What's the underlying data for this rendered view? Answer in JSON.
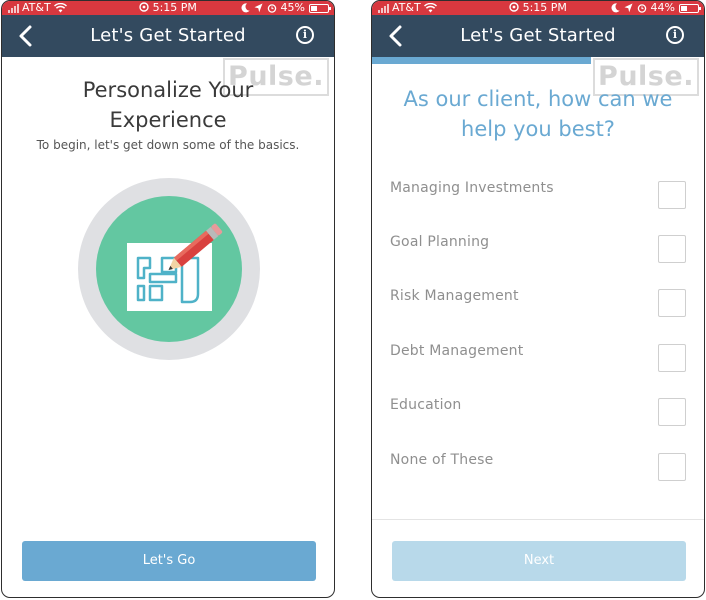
{
  "left_screen": {
    "status": {
      "carrier": "AT&T",
      "time": "5:15 PM",
      "battery": "45%",
      "battery_level": 0.45
    },
    "nav": {
      "title": "Let's Get Started"
    },
    "watermark": "Pulse.",
    "heading_line1": "Personalize Your",
    "heading_line2": "Experience",
    "subtitle": "To begin, let's get down some of the basics.",
    "button_label": "Let's Go"
  },
  "right_screen": {
    "status": {
      "carrier": "AT&T",
      "time": "5:15 PM",
      "battery": "44%",
      "battery_level": 0.44
    },
    "nav": {
      "title": "Let's Get Started"
    },
    "watermark": "Pulse.",
    "progress": 0.66,
    "question_line1": "As our client, how can we",
    "question_line2": "help you best?",
    "options": [
      {
        "label": "Managing Investments",
        "checked": false
      },
      {
        "label": "Goal Planning",
        "checked": false
      },
      {
        "label": "Risk Management",
        "checked": false
      },
      {
        "label": "Debt Management",
        "checked": false
      },
      {
        "label": "Education",
        "checked": false
      },
      {
        "label": "None of These",
        "checked": false
      }
    ],
    "button_label": "Next"
  },
  "colors": {
    "status_bar": "#d8383f",
    "nav_bar": "#334a5f",
    "accent_blue": "#6aa9d2",
    "disabled_blue": "#b8d9ea",
    "illustration_green": "#63c7a1",
    "illustration_ring": "#dfe0e3"
  },
  "icons": [
    "back-chevron-icon",
    "info-icon",
    "wifi-icon",
    "alarm-icon",
    "moon-icon",
    "location-icon",
    "pencil-icon",
    "floorplan-icon"
  ]
}
